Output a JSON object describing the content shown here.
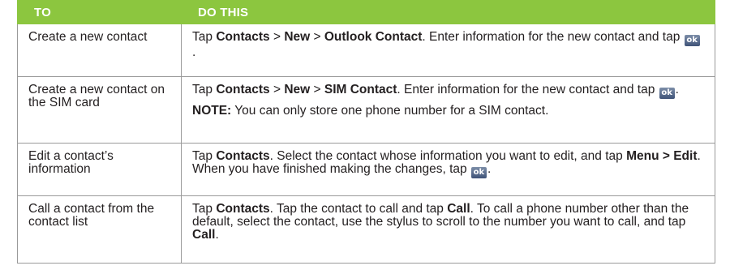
{
  "header": {
    "col1": "TO",
    "col2": "DO THIS"
  },
  "ok_icon_label": "ok",
  "rows": [
    {
      "to": "Create a new contact",
      "p1": "Tap ",
      "b1": "Contacts",
      "p2": " > ",
      "b2": "New",
      "p3": " > ",
      "b3": "Outlook Contact",
      "p4": ". Enter information for the new contact and tap ",
      "p5": "."
    },
    {
      "to": "Create a new contact on the SIM card",
      "p1": "Tap ",
      "b1": "Contacts",
      "p2": " > ",
      "b2": "New",
      "p3": " > ",
      "b3": "SIM Contact",
      "p4": ". Enter information for the new contact and tap ",
      "p5": ".",
      "note_label": "NOTE:",
      "note_text": " You can only store one phone number for a SIM contact."
    },
    {
      "to": "Edit a contact’s information",
      "p1": "Tap ",
      "b1": "Contacts",
      "p2": ". Select the contact whose information you want to edit, and tap ",
      "b2": "Menu > Edit",
      "p3": ". When you have finished making the changes, tap ",
      "p4": "."
    },
    {
      "to": "Call a contact from the contact list",
      "p1": "Tap ",
      "b1": "Contacts",
      "p2": ". Tap the contact to call and tap ",
      "b2": "Call",
      "p3": ". To call a phone number other than the default, select the contact, use the stylus to scroll to the number you want to call, and tap ",
      "b3": "Call",
      "p4": "."
    }
  ]
}
